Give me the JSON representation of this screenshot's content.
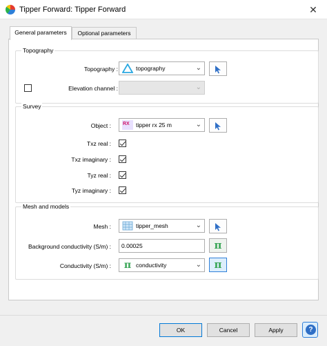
{
  "window": {
    "title": "Tipper Forward: Tipper Forward",
    "close_glyph": "✕"
  },
  "tabs": [
    {
      "label": "General parameters",
      "active": true
    },
    {
      "label": "Optional parameters",
      "active": false
    }
  ],
  "topography": {
    "group_title": "Topography",
    "topography_label": "Topography :",
    "topography_value": "topography",
    "elevation_checked": false,
    "elevation_label": "Elevation channel :",
    "elevation_value": ""
  },
  "survey": {
    "group_title": "Survey",
    "object_label": "Object :",
    "object_value": "tipper rx 25 m",
    "object_icon_text": "RX",
    "components": [
      {
        "label": "Txz real :",
        "checked": true
      },
      {
        "label": "Txz imaginary :",
        "checked": true
      },
      {
        "label": "Tyz real :",
        "checked": true
      },
      {
        "label": "Tyz imaginary :",
        "checked": true
      }
    ]
  },
  "mesh_models": {
    "group_title": "Mesh and models",
    "mesh_label": "Mesh :",
    "mesh_value": "tipper_mesh",
    "background_label": "Background conductivity (S/m) :",
    "background_value": "0.00025",
    "conductivity_label": "Conductivity (S/m) :",
    "conductivity_value": "conductivity",
    "pi_glyph": "π"
  },
  "buttons": {
    "ok": "OK",
    "cancel": "Cancel",
    "apply": "Apply",
    "help_glyph": "?"
  },
  "colors": {
    "accent_blue": "#2f7fd8",
    "pi_green": "#3aa657",
    "topo_icon": "#2aa8e0"
  }
}
